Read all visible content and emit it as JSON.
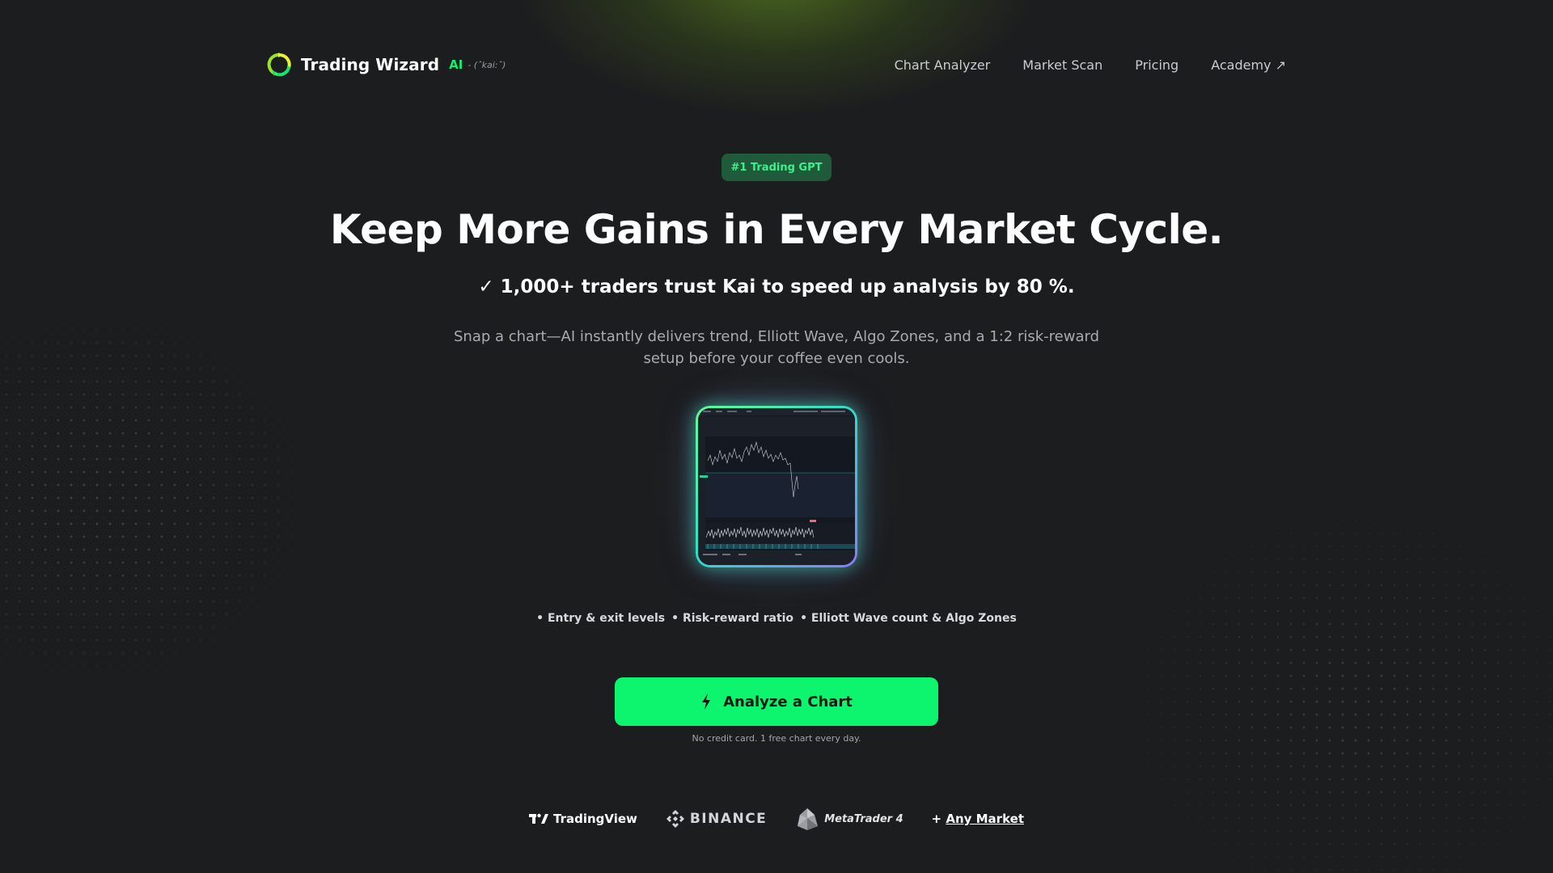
{
  "header": {
    "brand_name": "Trading Wizard",
    "brand_ai": "AI",
    "brand_kai": "- (ˆkai:ˆ)",
    "nav": [
      {
        "label": "Chart Analyzer"
      },
      {
        "label": "Market Scan"
      },
      {
        "label": "Pricing"
      },
      {
        "label": "Academy ↗"
      }
    ]
  },
  "hero": {
    "badge": "#1 Trading GPT",
    "title": "Keep More Gains in Every Market Cycle.",
    "trust": "✓ 1,000+ traders trust Kai to speed up analysis by 80 %.",
    "description": "Snap a chart—AI instantly delivers trend, Elliott Wave, Algo Zones, and a 1:2 risk-reward setup before your coffee even cools."
  },
  "features": [
    "• Entry & exit levels",
    "• Risk-reward ratio",
    "• Elliott Wave count & Algo Zones"
  ],
  "cta": {
    "label": "Analyze a Chart",
    "icon": "lightning-icon",
    "note": "No credit card. 1 free chart every day."
  },
  "logos": {
    "tradingview": "TradingView",
    "binance": "BINANCE",
    "metatrader": "MetaTrader 4",
    "any_prefix": "+ ",
    "any_market": "Any Market"
  },
  "colors": {
    "background": "#1c1d1f",
    "accent": "#0df56e",
    "badge_bg": "#1f5a3a",
    "badge_text": "#3df08a"
  }
}
